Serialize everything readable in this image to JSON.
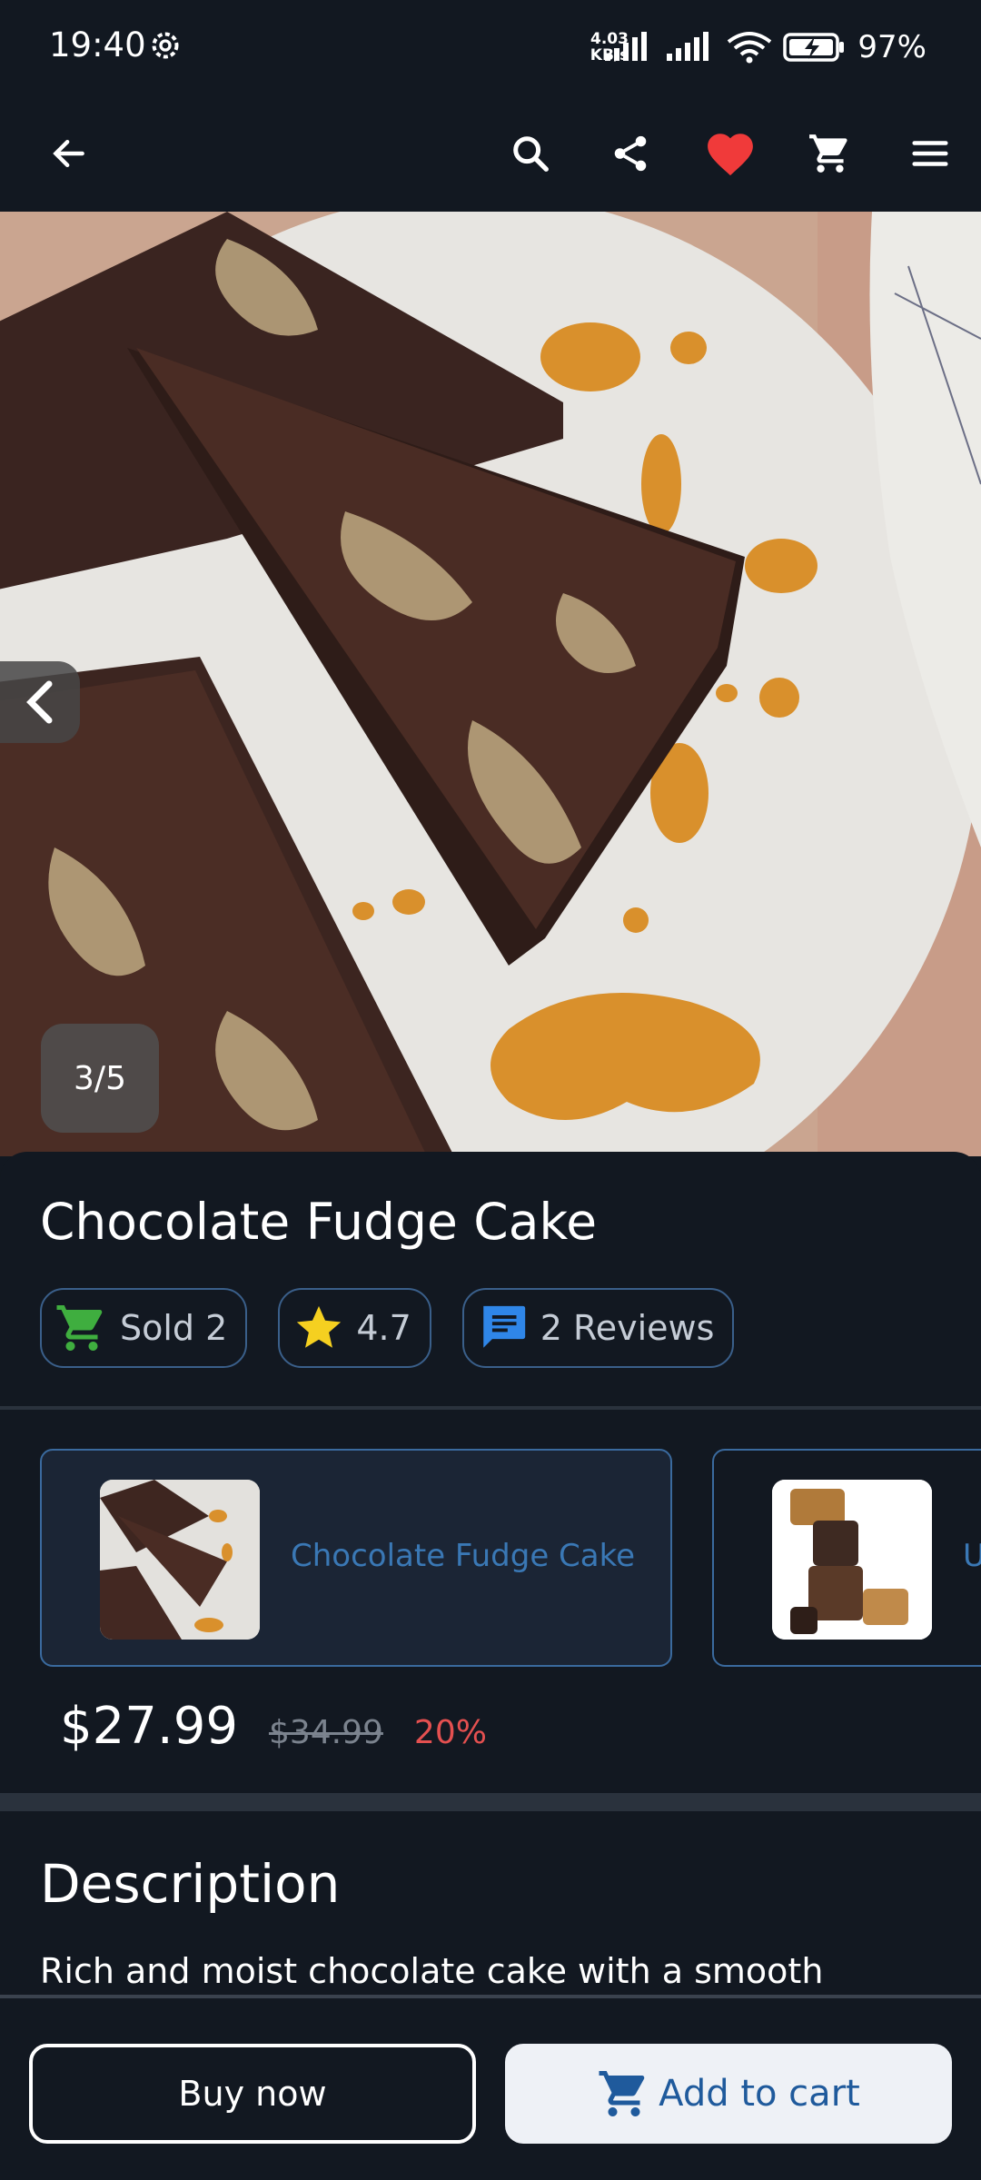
{
  "status": {
    "time": "19:40",
    "net_speed_value": "4.03",
    "net_speed_unit": "KB/s",
    "battery_pct": "97%"
  },
  "appbar": {
    "icons": [
      "back-arrow-icon",
      "search-icon",
      "share-icon",
      "heart-icon",
      "cart-icon",
      "menu-icon"
    ],
    "favorite_color": "#f03a3a"
  },
  "gallery": {
    "counter": "3/5"
  },
  "product": {
    "title": "Chocolate Fudge Cake",
    "chips": {
      "sold": "Sold 2",
      "rating": "4.7",
      "reviews": "2 Reviews"
    },
    "variants": [
      {
        "label": "Chocolate Fudge Cake"
      },
      {
        "label": "U"
      }
    ],
    "price": "$27.99",
    "original_price": "$34.99",
    "discount": "20%"
  },
  "description": {
    "heading": "Description",
    "text": "Rich and moist chocolate cake with a smooth"
  },
  "actions": {
    "buy_now": "Buy now",
    "add_to_cart": "Add to cart"
  },
  "colors": {
    "background": "#121821",
    "accent_blue": "#1f5a9c",
    "chip_border": "#3a5f8a",
    "sold_green": "#3fae3f",
    "star_yellow": "#f5d020",
    "review_blue": "#2f86e8",
    "discount_red": "#e45050"
  }
}
